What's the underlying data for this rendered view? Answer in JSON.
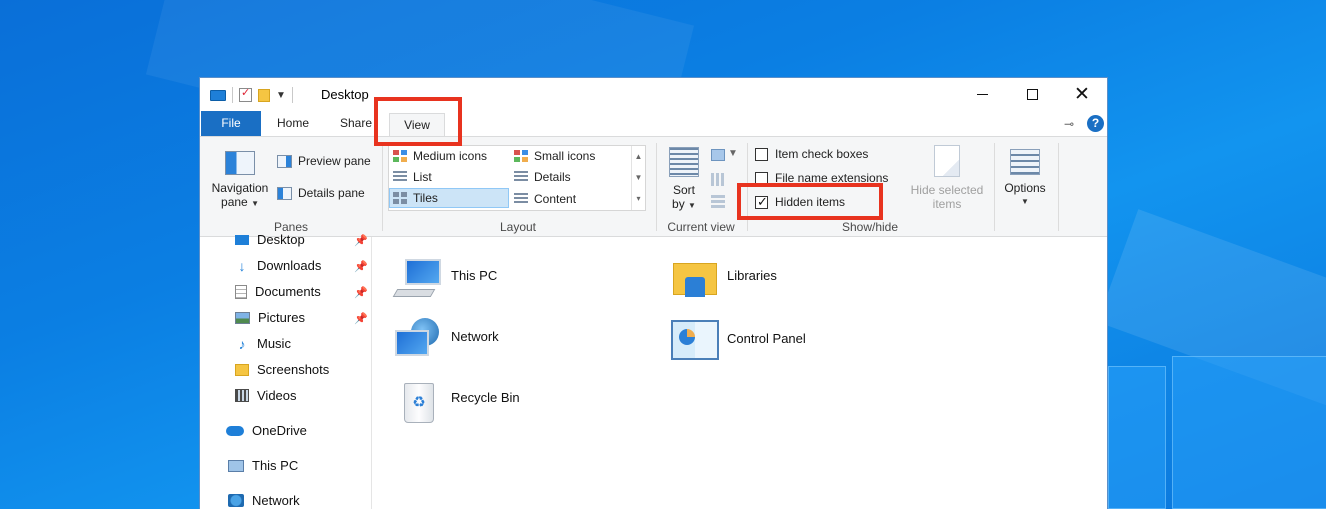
{
  "window": {
    "title": "Desktop"
  },
  "caption_buttons": {
    "minimize": "minimize",
    "maximize": "maximize",
    "close": "close"
  },
  "tabs": [
    {
      "label": "File"
    },
    {
      "label": "Home"
    },
    {
      "label": "Share"
    },
    {
      "label": "View"
    }
  ],
  "ribbon": {
    "panes": {
      "navigation_pane_line1": "Navigation",
      "navigation_pane_line2": "pane",
      "preview_pane": "Preview pane",
      "details_pane": "Details pane",
      "group_label": "Panes"
    },
    "layout": {
      "items": [
        "Medium icons",
        "Small icons",
        "List",
        "Details",
        "Tiles",
        "Content"
      ],
      "selected": "Tiles",
      "group_label": "Layout"
    },
    "current_view": {
      "sort_line1": "Sort",
      "sort_line2": "by",
      "group_label": "Current view"
    },
    "show_hide": {
      "item_check_boxes": {
        "label": "Item check boxes",
        "checked": false
      },
      "file_name_extensions": {
        "label": "File name extensions",
        "checked": false
      },
      "hidden_items": {
        "label": "Hidden items",
        "checked": true
      },
      "hide_selected_line1": "Hide selected",
      "hide_selected_line2": "items",
      "group_label": "Show/hide"
    },
    "options": {
      "label": "Options"
    }
  },
  "nav_tree": [
    {
      "label": "Desktop",
      "icon": "desktop-icon",
      "pinned": true
    },
    {
      "label": "Downloads",
      "icon": "download-icon",
      "pinned": true
    },
    {
      "label": "Documents",
      "icon": "document-icon",
      "pinned": true
    },
    {
      "label": "Pictures",
      "icon": "picture-icon",
      "pinned": true
    },
    {
      "label": "Music",
      "icon": "music-icon",
      "pinned": false
    },
    {
      "label": "Screenshots",
      "icon": "folder-icon",
      "pinned": false
    },
    {
      "label": "Videos",
      "icon": "video-icon",
      "pinned": false
    },
    {
      "label": "OneDrive",
      "icon": "onedrive-icon",
      "pinned": false
    },
    {
      "label": "This PC",
      "icon": "this-pc-icon",
      "pinned": false
    },
    {
      "label": "Network",
      "icon": "network-icon",
      "pinned": false
    }
  ],
  "content_items": [
    {
      "label": "This PC",
      "icon": "this-pc-icon"
    },
    {
      "label": "Libraries",
      "icon": "libraries-icon"
    },
    {
      "label": "Network",
      "icon": "network-icon"
    },
    {
      "label": "Control Panel",
      "icon": "control-panel-icon"
    },
    {
      "label": "Recycle Bin",
      "icon": "recycle-bin-icon"
    }
  ],
  "colors": {
    "file_tab": "#1a6fc4",
    "highlight": "#e8331f",
    "desktop_blue": "#0b7fe3"
  }
}
